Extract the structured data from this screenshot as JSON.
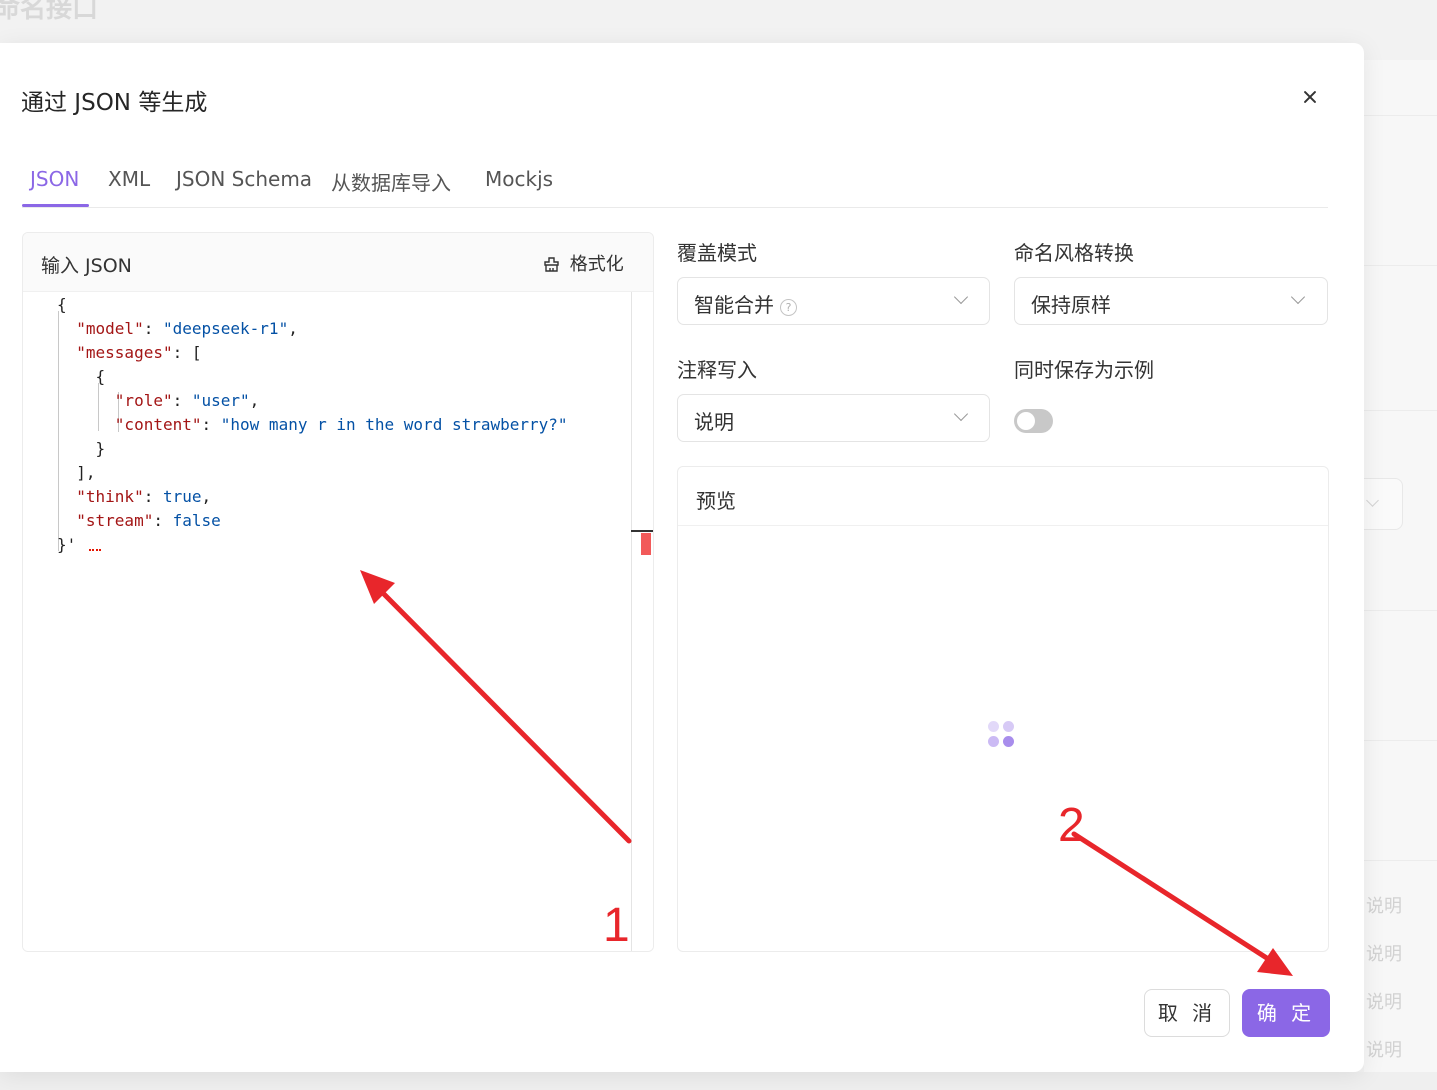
{
  "background": {
    "page_title": "命名接口",
    "side_notes": [
      "说明",
      "说明",
      "说明",
      "说明"
    ]
  },
  "modal": {
    "title": "通过 JSON 等生成",
    "tabs": [
      {
        "label": "JSON",
        "active": true
      },
      {
        "label": "XML",
        "active": false
      },
      {
        "label": "JSON Schema",
        "active": false
      },
      {
        "label": "从数据库导入",
        "active": false
      },
      {
        "label": "Mockjs",
        "active": false
      }
    ],
    "editor": {
      "label": "输入 JSON",
      "format_label": "格式化",
      "lines": [
        "{",
        "  \"model\": \"deepseek-r1\",",
        "  \"messages\": [",
        "    {",
        "      \"role\": \"user\",",
        "      \"content\": \"how many r in the word strawberry?\"",
        "    }",
        "  ],",
        "  \"think\": true,",
        "  \"stream\": false",
        "}'"
      ]
    },
    "fields": {
      "overwrite_mode": {
        "label": "覆盖模式",
        "value": "智能合并"
      },
      "naming_style": {
        "label": "命名风格转换",
        "value": "保持原样"
      },
      "comment_write": {
        "label": "注释写入",
        "value": "说明"
      },
      "save_example": {
        "label": "同时保存为示例",
        "enabled": false
      }
    },
    "preview": {
      "label": "预览"
    },
    "buttons": {
      "cancel": "取 消",
      "ok": "确 定"
    }
  },
  "annotations": {
    "labels": [
      "1",
      "2"
    ],
    "color": "#e8262b"
  },
  "colors": {
    "accent": "#8b67e6",
    "annotation": "#e8262b"
  }
}
